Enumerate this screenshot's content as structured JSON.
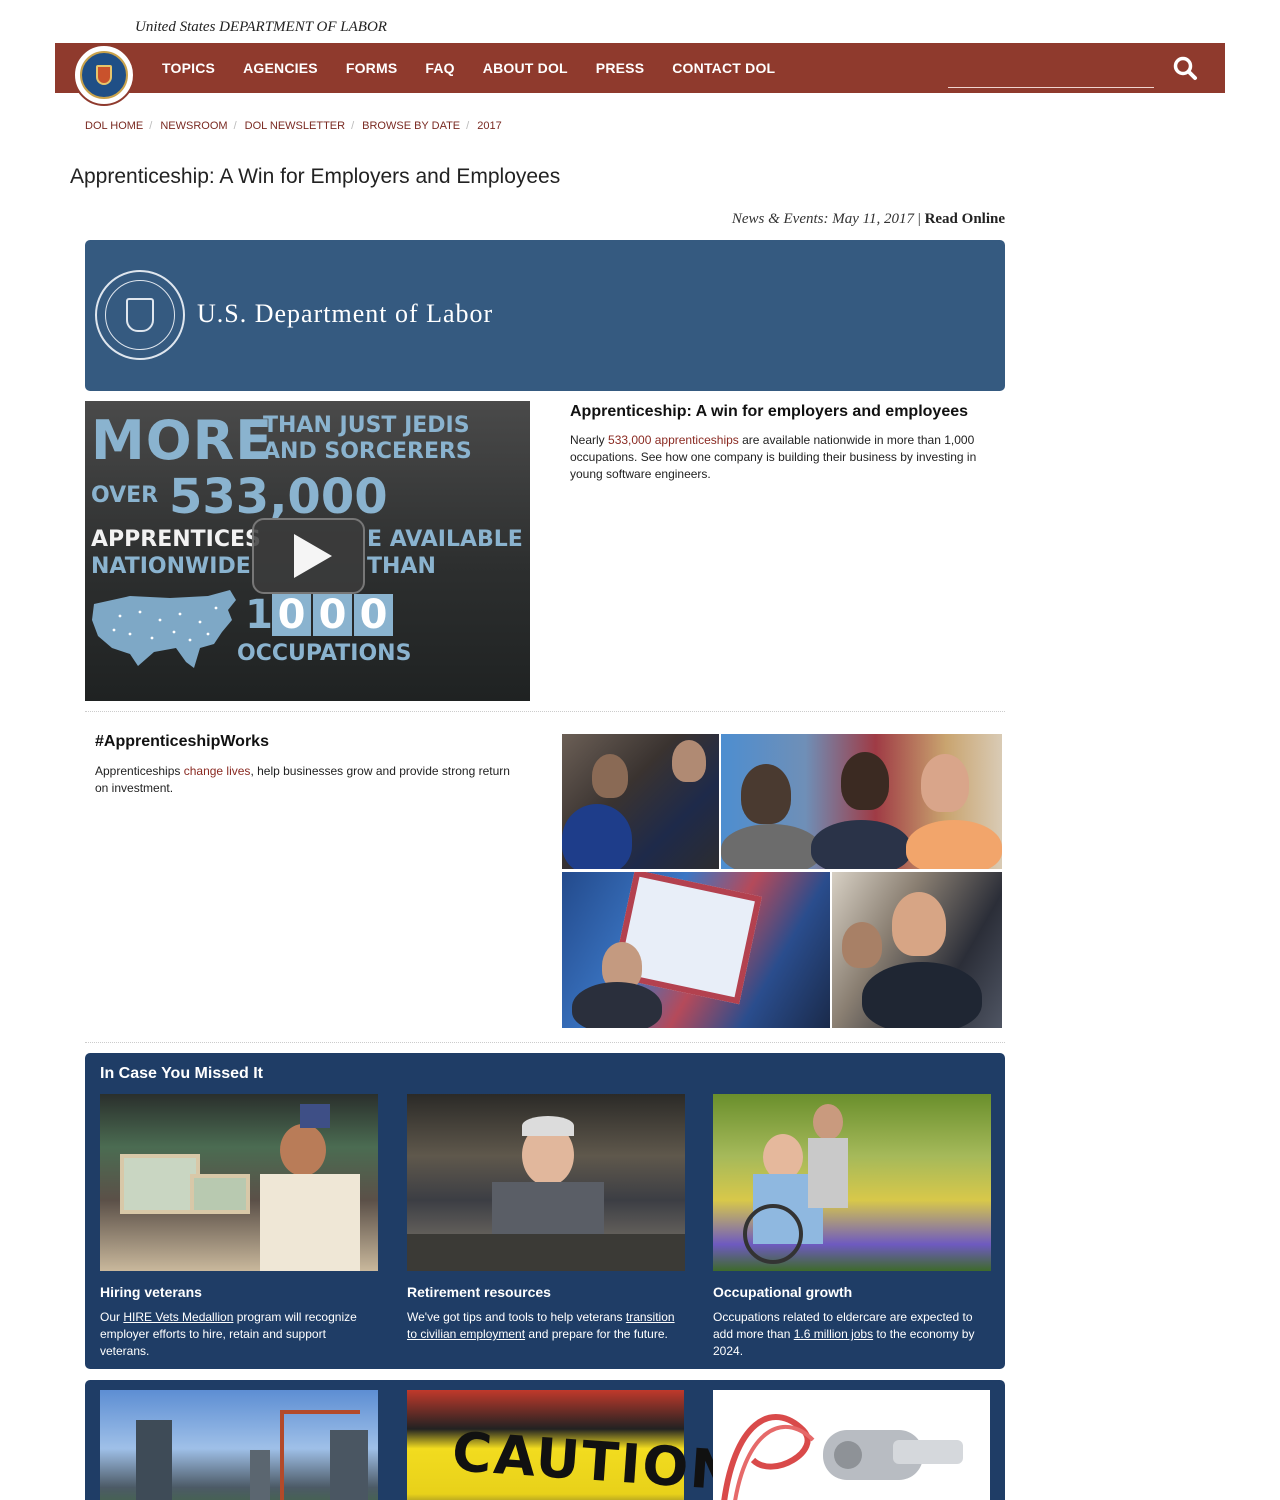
{
  "header": {
    "agency_line": "United States DEPARTMENT OF LABOR",
    "nav": [
      "TOPICS",
      "AGENCIES",
      "FORMS",
      "FAQ",
      "ABOUT DOL",
      "PRESS",
      "CONTACT DOL"
    ],
    "search_placeholder": "",
    "colors": {
      "nav_bg": "#8f3a2d"
    }
  },
  "breadcrumb": [
    "DOL HOME",
    "NEWSROOM",
    "DOL NEWSLETTER",
    "BROWSE BY DATE",
    "2017"
  ],
  "page_title": "Apprenticeship: A Win for Employers and Employees",
  "news_line": {
    "label": "News & Events: May 11, 2017",
    "separator": "|",
    "read_online": "Read Online"
  },
  "banner": {
    "text": "U.S. Department of Labor",
    "color": "#355a80"
  },
  "video": {
    "line1a": "MORE",
    "line1b": "THAN JUST JEDIS",
    "line1c": "AND SORCERERS",
    "line2a": "OVER",
    "line2b": "533,000",
    "line3a": "APPRENTICES",
    "line3b": "E AVAILABLE",
    "line4a": "NATIONWIDE",
    "line4b": "THAN",
    "digits": [
      "1",
      "0",
      "0",
      "0"
    ],
    "line5": "OCCUPATIONS"
  },
  "feature": {
    "title": "Apprenticeship: A win for employers and employees",
    "text_before": "Nearly ",
    "link": "533,000 apprenticeships",
    "text_after": " are available nationwide in more than 1,000 occupations. See how one company is building their business by investing in young software engineers."
  },
  "apprenticeship_works": {
    "title": "#ApprenticeshipWorks",
    "text_before": "Apprenticeships ",
    "link": "change lives",
    "text_after": ", help businesses grow and provide strong return on investment."
  },
  "missed": {
    "title": "In Case You Missed It",
    "cards": [
      {
        "title": "Hiring veterans",
        "text_before": "Our ",
        "link": "HIRE Vets Medallion",
        "text_after": " program will recognize employer efforts to hire, retain and support veterans."
      },
      {
        "title": "Retirement resources",
        "text_before": "We've got tips and tools to help veterans ",
        "link": "transition to civilian employment",
        "text_after": " and prepare for the future."
      },
      {
        "title": "Occupational growth",
        "text_before": "Occupations related to eldercare are expected to add more than ",
        "link": "1.6 million jobs",
        "text_after": " to the economy by 2024."
      }
    ],
    "color": "#1f3d66"
  },
  "more": {
    "caution_text": "CAUTION"
  }
}
